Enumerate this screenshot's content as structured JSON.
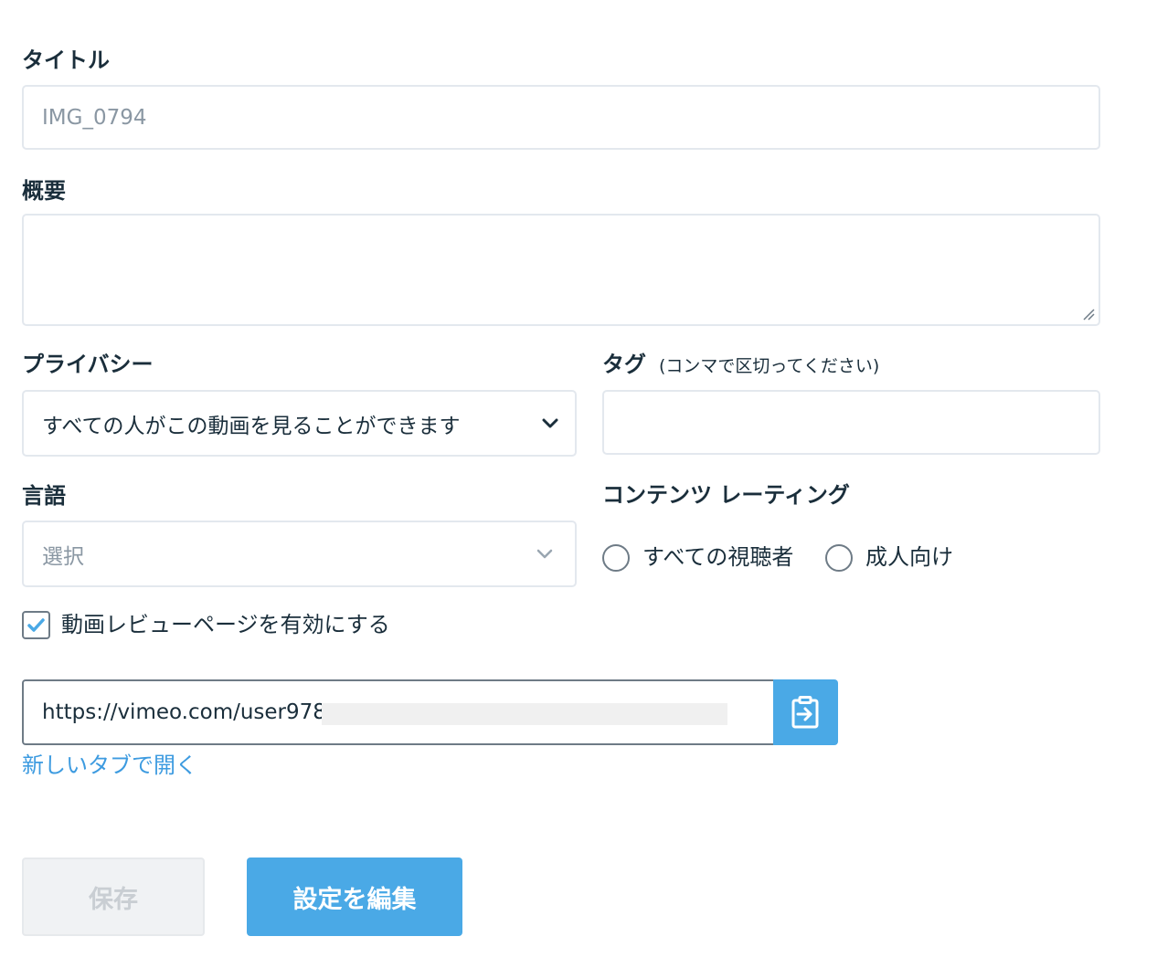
{
  "title_field": {
    "label": "タイトル",
    "placeholder": "IMG_0794"
  },
  "description_field": {
    "label": "概要",
    "value": ""
  },
  "privacy": {
    "label": "プライバシー",
    "selected": "すべての人がこの動画を見ることができます"
  },
  "tags": {
    "label": "タグ",
    "hint": "(コンマで区切ってください)",
    "value": ""
  },
  "language": {
    "label": "言語",
    "placeholder": "選択"
  },
  "content_rating": {
    "label": "コンテンツ レーティング",
    "options": [
      "すべての視聴者",
      "成人向け"
    ]
  },
  "review_page": {
    "checkbox_label": "動画レビューページを有効にする",
    "checked": true,
    "url": "https://vimeo.com/user978",
    "open_link": "新しいタブで開く"
  },
  "buttons": {
    "save": "保存",
    "edit_settings": "設定を編集"
  },
  "colors": {
    "accent": "#4aa9e6",
    "link": "#3d9be0",
    "text": "#1a2e3b",
    "border": "#e3e8ee"
  },
  "icons": {
    "select": "chevron-down-icon",
    "copy": "clipboard-icon",
    "check": "checkmark-icon"
  }
}
